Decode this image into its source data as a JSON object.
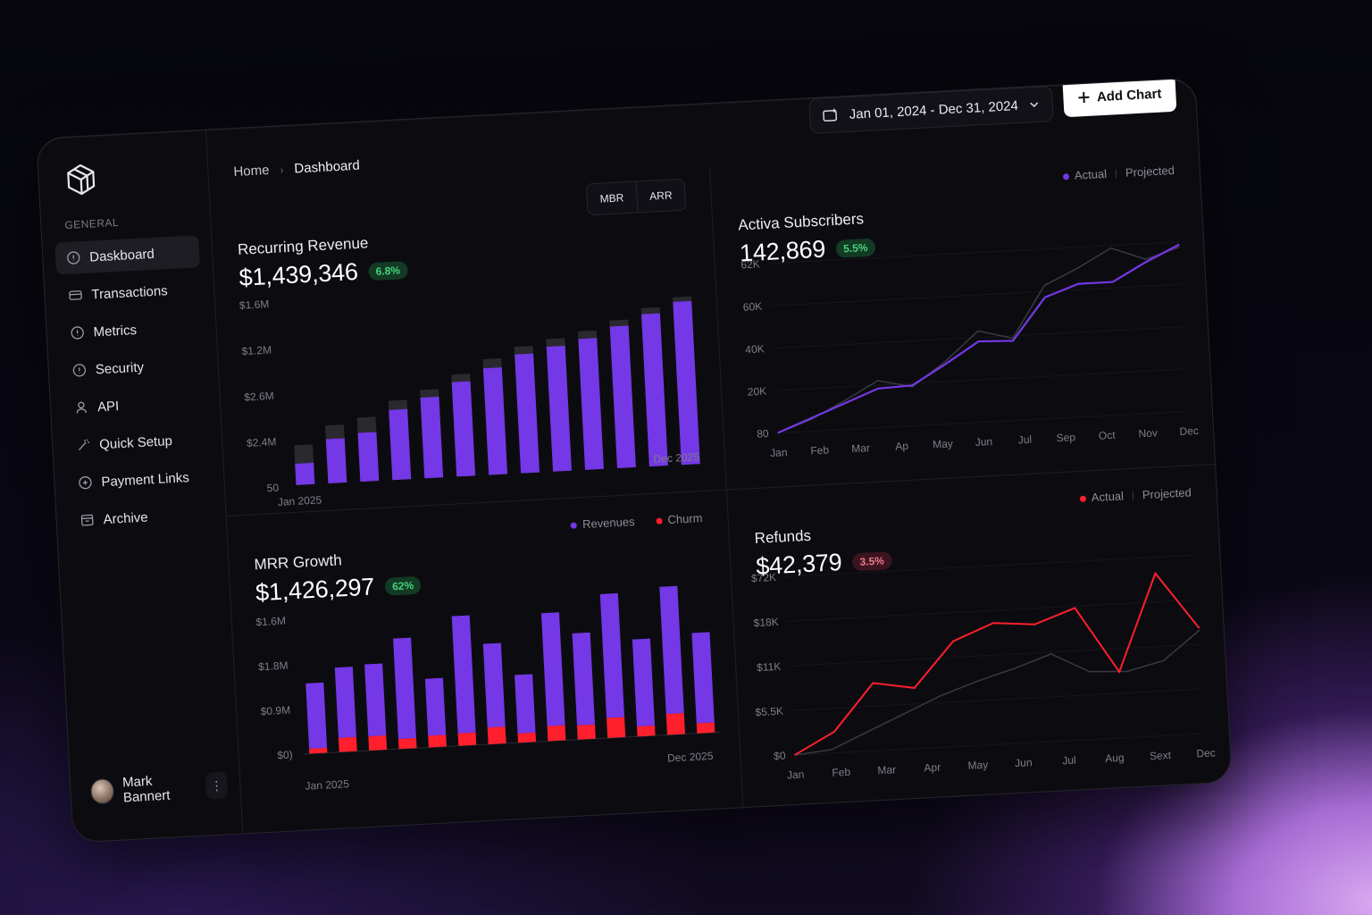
{
  "sidebar": {
    "section_label": "GENERAL",
    "items": [
      {
        "label": "Daskboard",
        "icon": "info-circle-icon",
        "active": true
      },
      {
        "label": "Transactions",
        "icon": "card-icon"
      },
      {
        "label": "Metrics",
        "icon": "info-circle-icon"
      },
      {
        "label": "Security",
        "icon": "info-circle-icon"
      },
      {
        "label": "API",
        "icon": "person-icon"
      },
      {
        "label": "Quick Setup",
        "icon": "wand-icon"
      },
      {
        "label": "Payment Links",
        "icon": "link-circle-icon"
      },
      {
        "label": "Archive",
        "icon": "archive-icon"
      }
    ],
    "user": {
      "name": "Mark Bannert",
      "menu": "⋮"
    }
  },
  "header": {
    "breadcrumb": {
      "home": "Home",
      "separator": "›",
      "current": "Dashboard"
    },
    "date_range": "Jan 01, 2024 - Dec 31, 2024",
    "add_chart_label": "Add Chart"
  },
  "colors": {
    "accent": "#7438e6",
    "churn": "#ff1f2d",
    "positive": "#46d27a",
    "negative": "#f07a8a"
  },
  "panels": {
    "recurring": {
      "title": "Recurring Revenue",
      "value": "$1,439,346",
      "badge": "6.8%",
      "toggle": [
        "MBR",
        "ARR"
      ]
    },
    "subscribers": {
      "title": "Activa Subscribers",
      "value": "142,869",
      "badge": "5.5%",
      "legend": {
        "actual": "Actual",
        "projected": "Projected"
      }
    },
    "mrr": {
      "title": "MRR Growth",
      "value": "$1,426,297",
      "badge": "62%",
      "legend": {
        "revenues": "Revenues",
        "churn": "Churm"
      }
    },
    "refunds": {
      "title": "Refunds",
      "value": "$42,379",
      "badge": "3.5%",
      "legend": {
        "actual": "Actual",
        "projected": "Projected"
      }
    }
  },
  "chart_data": [
    {
      "id": "recurring",
      "type": "bar",
      "y_ticks": [
        "$1.6M",
        "$1.2M",
        "$2.6M",
        "$2.4M",
        "50"
      ],
      "x_start_label": "Jan 2025",
      "x_end_label": "Dec 2025",
      "ylim": [
        0,
        1.6
      ],
      "series": [
        {
          "name": "Actual",
          "values": [
            0.14,
            0.29,
            0.32,
            0.46,
            0.53,
            0.62,
            0.7,
            0.78,
            0.82,
            0.86,
            0.93,
            1.0,
            1.07
          ]
        },
        {
          "name": "Projected",
          "values": [
            0.26,
            0.38,
            0.42,
            0.52,
            0.58,
            0.67,
            0.76,
            0.83,
            0.87,
            0.91,
            0.97,
            1.04,
            1.1
          ]
        }
      ]
    },
    {
      "id": "subscribers",
      "type": "line",
      "categories": [
        "Jan",
        "Feb",
        "Mar",
        "Ap",
        "May",
        "Jun",
        "Jul",
        "Sep",
        "Oct",
        "Nov",
        "Dec"
      ],
      "y_ticks": [
        "62K",
        "60K",
        "40K",
        "20K",
        "80"
      ],
      "series": [
        {
          "name": "Actual",
          "values": [
            0.0,
            0.1,
            0.2,
            0.3,
            0.31,
            0.46,
            0.62,
            0.61,
            0.93,
            1.02,
            1.02,
            1.16,
            1.28
          ]
        },
        {
          "name": "Projected",
          "values": [
            0.0,
            0.09,
            0.22,
            0.36,
            0.3,
            0.48,
            0.7,
            0.63,
            1.02,
            1.14,
            1.28,
            1.18,
            1.26
          ]
        }
      ]
    },
    {
      "id": "mrr",
      "type": "bar",
      "y_ticks": [
        "$1.6M",
        "$1.8M",
        "$0.9M",
        "$0)"
      ],
      "x_start_label": "Jan 2025",
      "x_end_label": "Dec 2025",
      "series": [
        {
          "name": "Revenues",
          "values": [
            0.78,
            0.84,
            0.86,
            1.2,
            0.68,
            1.4,
            1.0,
            0.7,
            1.35,
            1.1,
            1.48,
            1.04,
            1.52,
            1.08
          ]
        },
        {
          "name": "Churm",
          "values": [
            0.06,
            0.17,
            0.17,
            0.12,
            0.14,
            0.15,
            0.2,
            0.11,
            0.18,
            0.17,
            0.24,
            0.12,
            0.25,
            0.12
          ]
        }
      ]
    },
    {
      "id": "refunds",
      "type": "line",
      "categories": [
        "Jan",
        "Feb",
        "Mar",
        "Apr",
        "May",
        "Jun",
        "Jul",
        "Aug",
        "Sext",
        "Dec"
      ],
      "y_ticks": [
        "$72K",
        "$18K",
        "$11K",
        "$5.5K",
        "$0"
      ],
      "series": [
        {
          "name": "Actual",
          "values": [
            0.0,
            0.12,
            0.38,
            0.34,
            0.59,
            0.68,
            0.66,
            0.74,
            0.37,
            0.91,
            0.59
          ]
        },
        {
          "name": "Projected",
          "values": [
            0.0,
            0.02,
            0.11,
            0.2,
            0.29,
            0.36,
            0.42,
            0.49,
            0.38,
            0.37,
            0.42,
            0.58
          ]
        }
      ]
    }
  ]
}
